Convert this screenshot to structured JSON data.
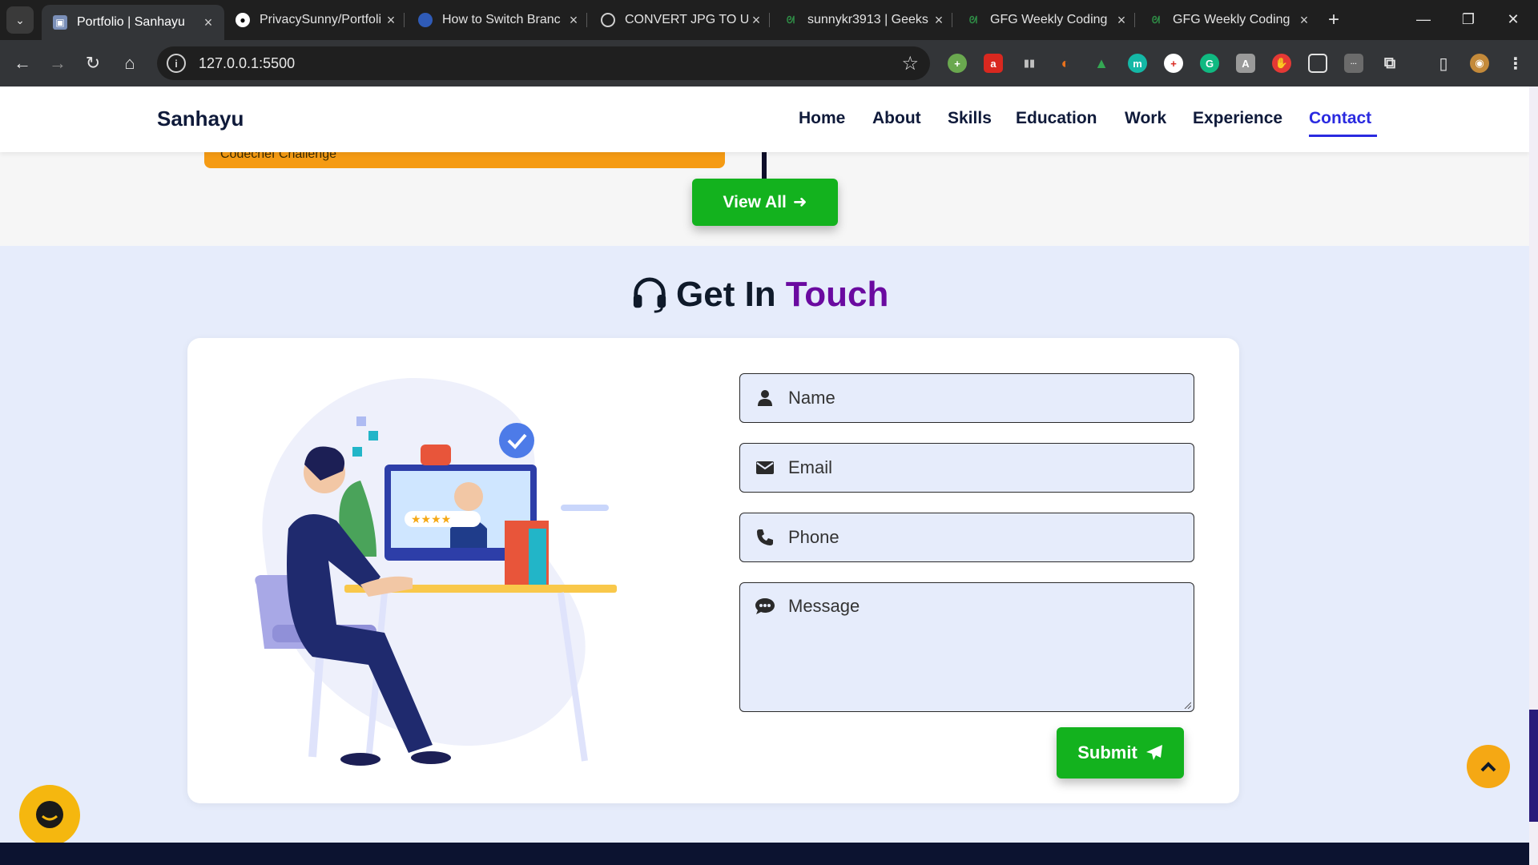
{
  "browser": {
    "tabs": [
      {
        "title": "Portfolio | Sanhayu",
        "favicon": "portfolio-favicon",
        "active": true
      },
      {
        "title": "PrivacySunny/Portfoli",
        "favicon": "github-icon"
      },
      {
        "title": "How to Switch Branc",
        "favicon": "browser-globe-icon"
      },
      {
        "title": "CONVERT JPG TO UR",
        "favicon": "globe-icon"
      },
      {
        "title": "sunnykr3913 | Geeks",
        "favicon": "gfg-icon"
      },
      {
        "title": "GFG Weekly Coding",
        "favicon": "gfg-icon"
      },
      {
        "title": "GFG Weekly Coding",
        "favicon": "gfg-icon"
      }
    ],
    "url": "127.0.0.1:5500",
    "extension_colors": [
      "#6aa84f",
      "#d9281f",
      "#c0c0c0",
      "#e8711c",
      "#34a853",
      "#14b8a6",
      "#ffffff",
      "#10b981",
      "#9a9a9a",
      "#e53935",
      "#e3e3e3",
      "#6b6b6b"
    ]
  },
  "page": {
    "brand": "Sanhayu",
    "nav": [
      {
        "label": "Home"
      },
      {
        "label": "About"
      },
      {
        "label": "Skills"
      },
      {
        "label": "Education"
      },
      {
        "label": "Work"
      },
      {
        "label": "Experience"
      },
      {
        "label": "Contact",
        "active": true
      }
    ],
    "orange_card_text": "Codechef Challenge",
    "view_all_label": "View All",
    "heading": {
      "part1": "Get In",
      "part2": "Touch"
    },
    "form": {
      "name_placeholder": "Name",
      "email_placeholder": "Email",
      "phone_placeholder": "Phone",
      "message_placeholder": "Message",
      "submit_label": "Submit"
    },
    "colors": {
      "accent_green": "#13b21e",
      "accent_purple": "#6a0aa0",
      "nav_active": "#2a2ae0",
      "orange": "#f59b14"
    }
  }
}
